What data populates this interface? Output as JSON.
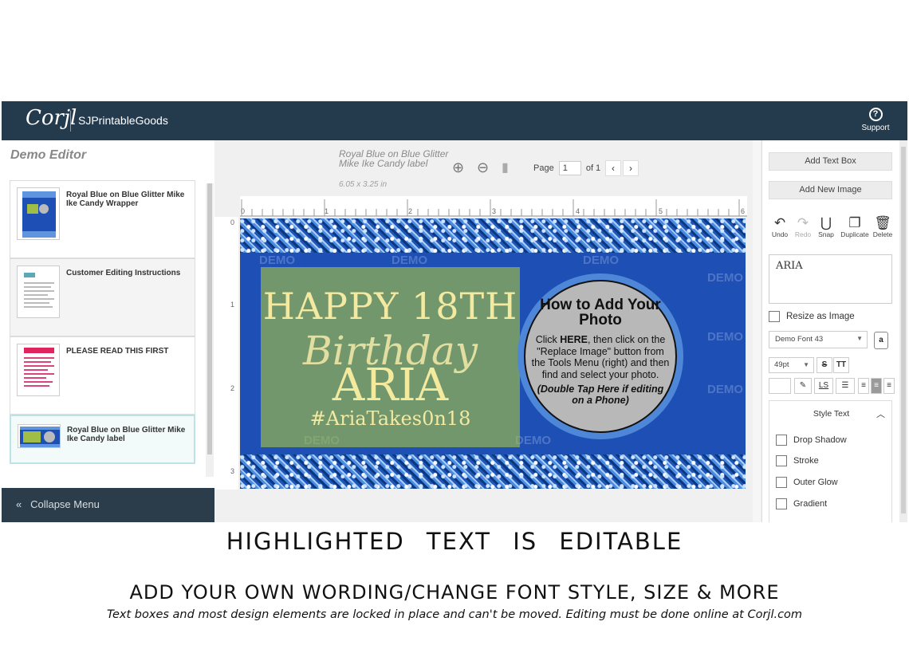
{
  "topbar": {
    "logo": "Corjl",
    "shop_name": "SJPrintableGoods",
    "support_label": "Support"
  },
  "left_panel": {
    "title": "Demo Editor",
    "templates": [
      {
        "name": "Royal Blue on Blue Glitter Mike Ike Candy Wrapper"
      },
      {
        "name": "Customer Editing Instructions"
      },
      {
        "name": "PLEASE READ THIS FIRST"
      },
      {
        "name": "Royal Blue on Blue Glitter Mike Ike Candy label"
      }
    ],
    "collapse_label": "Collapse Menu"
  },
  "toolbar": {
    "doc_name": "Royal Blue on Blue Glitter Mike Ike Candy label",
    "doc_size": "6.05 x 3.25 in",
    "page_label": "Page",
    "page_value": "1",
    "page_of": "of 1"
  },
  "ruler": {
    "top_numbers": [
      "0",
      "1",
      "2",
      "3",
      "4",
      "5",
      "6"
    ],
    "left_numbers": [
      "0",
      "1",
      "2",
      "3"
    ]
  },
  "canvas": {
    "line1": "HAPPY 18TH",
    "line2": "Birthday",
    "line3": "ARIA",
    "line4": "#AriaTakes0n18",
    "photo_title": "How to Add Your Photo",
    "photo_instructions_pre": "Click ",
    "photo_instructions_here": "HERE",
    "photo_instructions_post": ", then click on the \"Replace Image\" button from the Tools Menu (right) and then find and select your photo.",
    "photo_phone_note": "(Double Tap Here if editing on a Phone)",
    "watermark": "DEMO"
  },
  "right_panel": {
    "add_text_box": "Add Text Box",
    "add_new_image": "Add New Image",
    "tools": [
      {
        "label": "Undo",
        "icon": "↶"
      },
      {
        "label": "Redo",
        "icon": "↷"
      },
      {
        "label": "Snap",
        "icon": "⋃"
      },
      {
        "label": "Duplicate",
        "icon": "❐"
      },
      {
        "label": "Delete",
        "icon": "🗑"
      }
    ],
    "text_value": "ARIA",
    "resize_as_image": "Resize as Image",
    "font_name": "Demo Font 43",
    "font_size": "49pt",
    "style_text_header": "Style Text",
    "style_options": [
      "Drop Shadow",
      "Stroke",
      "Outer Glow",
      "Gradient"
    ]
  },
  "captions": {
    "highlighted": "HIGHLIGHTED TEXT IS EDITABLE",
    "add_wording": "ADD YOUR OWN WORDING/CHANGE FONT STYLE, SIZE & MORE",
    "note": "Text boxes and most design elements are locked in place and can't be moved. Editing must be done online at Corjl.com"
  },
  "colors": {
    "topbar": "#243a4d",
    "canvas_blue": "#1d4fb5",
    "highlight": "#a0be46",
    "gold_text": "#f4ea9e"
  }
}
